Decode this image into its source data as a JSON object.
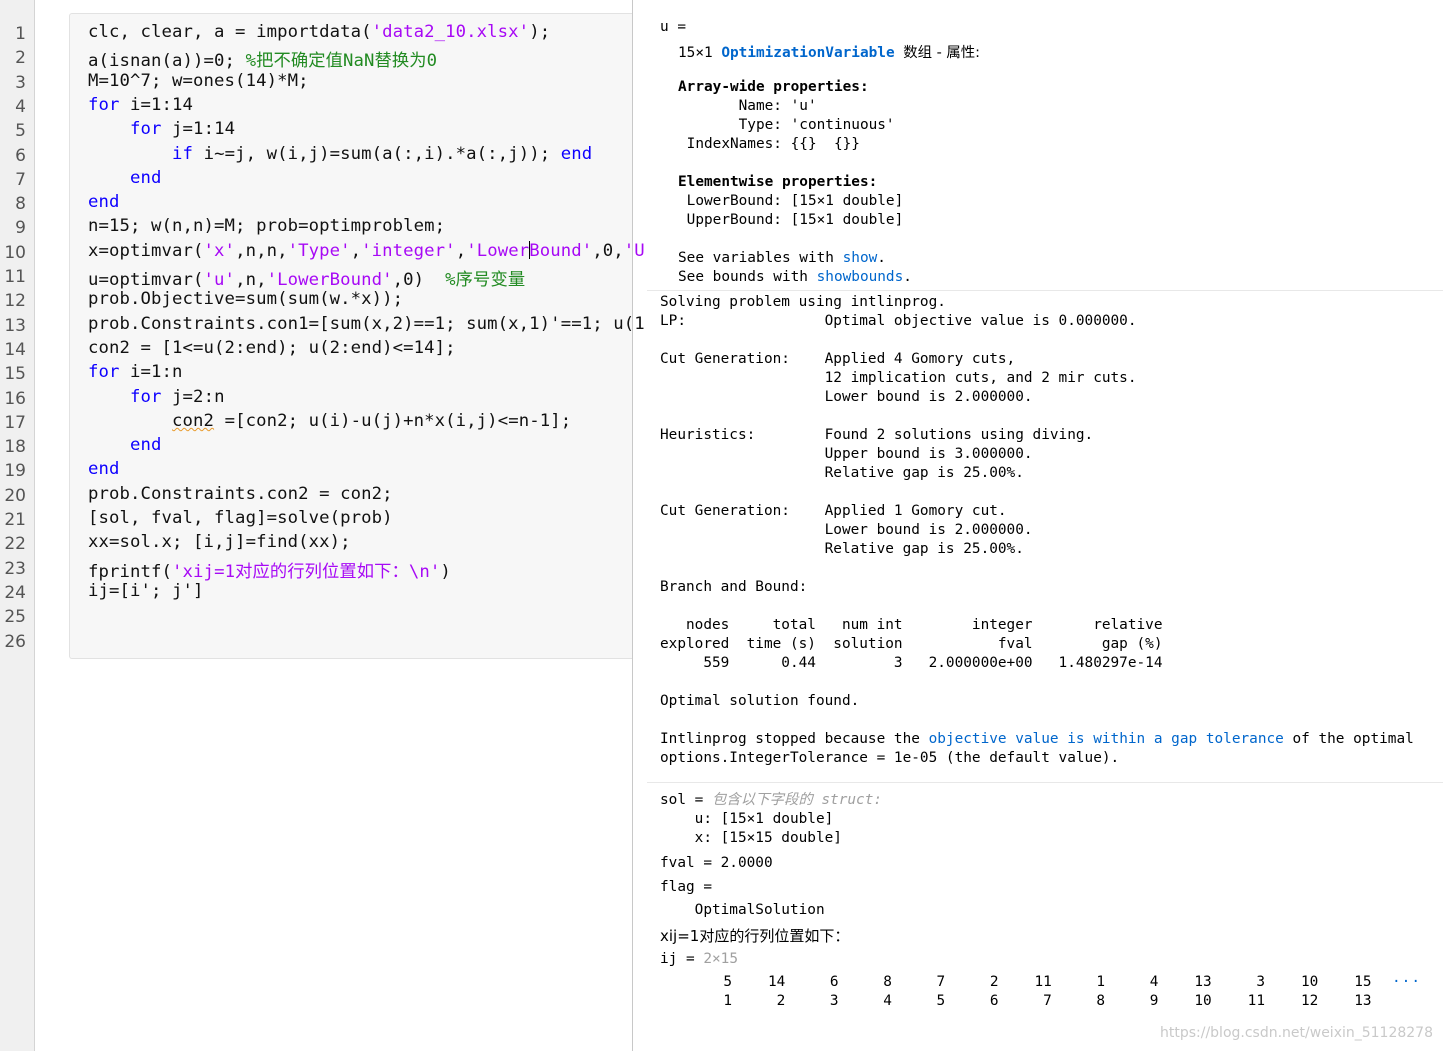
{
  "editor": {
    "line_numbers": [
      "1",
      "2",
      "3",
      "4",
      "5",
      "6",
      "7",
      "8",
      "9",
      "10",
      "11",
      "12",
      "13",
      "14",
      "15",
      "16",
      "17",
      "18",
      "19",
      "20",
      "21",
      "22",
      "23",
      "24",
      "25",
      "26"
    ],
    "lines": [
      [
        {
          "t": "clc, clear, a = importdata(",
          "c": "n"
        },
        {
          "t": "'data2_10.xlsx'",
          "c": "s"
        },
        {
          "t": ");",
          "c": "n"
        }
      ],
      [
        {
          "t": "a(isnan(a))=0; ",
          "c": "n"
        },
        {
          "t": "%把不确定值NaN替换为0",
          "c": "c"
        }
      ],
      [
        {
          "t": "M=10^7; w=ones(14)*M;",
          "c": "n"
        }
      ],
      [
        {
          "t": "for",
          "c": "k"
        },
        {
          "t": " i=1:14",
          "c": "n"
        }
      ],
      [
        {
          "t": "    ",
          "c": "n"
        },
        {
          "t": "for",
          "c": "k"
        },
        {
          "t": " j=1:14",
          "c": "n"
        }
      ],
      [
        {
          "t": "        ",
          "c": "n"
        },
        {
          "t": "if",
          "c": "k"
        },
        {
          "t": " i~=j, w(i,j)=sum(a(:,i).*a(:,j)); ",
          "c": "n"
        },
        {
          "t": "end",
          "c": "k"
        }
      ],
      [
        {
          "t": "    ",
          "c": "n"
        },
        {
          "t": "end",
          "c": "k"
        }
      ],
      [
        {
          "t": "end",
          "c": "k"
        }
      ],
      [
        {
          "t": "n=15; w(n,n)=M; prob=optimproblem;",
          "c": "n"
        }
      ],
      [
        {
          "t": "x=optimvar(",
          "c": "n"
        },
        {
          "t": "'x'",
          "c": "s"
        },
        {
          "t": ",n,n,",
          "c": "n"
        },
        {
          "t": "'Type'",
          "c": "s"
        },
        {
          "t": ",",
          "c": "n"
        },
        {
          "t": "'integer'",
          "c": "s"
        },
        {
          "t": ",",
          "c": "n"
        },
        {
          "t": "'Lower",
          "c": "s"
        },
        {
          "t": "",
          "c": "cursor"
        },
        {
          "t": "Bound'",
          "c": "s"
        },
        {
          "t": ",0,",
          "c": "n"
        },
        {
          "t": "'U",
          "c": "s"
        }
      ],
      [
        {
          "t": "u=optimvar(",
          "c": "n"
        },
        {
          "t": "'u'",
          "c": "s"
        },
        {
          "t": ",n,",
          "c": "n"
        },
        {
          "t": "'LowerBound'",
          "c": "s"
        },
        {
          "t": ",0)  ",
          "c": "n"
        },
        {
          "t": "%序号变量",
          "c": "c"
        }
      ],
      [
        {
          "t": "prob.Objective=sum(sum(w.*x));",
          "c": "n"
        }
      ],
      [
        {
          "t": "prob.Constraints.con1=[sum(x,2)==1; sum(x,1)'==1; u(1",
          "c": "n"
        }
      ],
      [
        {
          "t": "con2 = [1<=u(2:end); u(2:end)<=14];",
          "c": "n"
        }
      ],
      [
        {
          "t": "for",
          "c": "k"
        },
        {
          "t": " i=1:n",
          "c": "n"
        }
      ],
      [
        {
          "t": "    ",
          "c": "n"
        },
        {
          "t": "for",
          "c": "k"
        },
        {
          "t": " j=2:n",
          "c": "n"
        }
      ],
      [
        {
          "t": "        ",
          "c": "n"
        },
        {
          "t": "con2",
          "c": "w"
        },
        {
          "t": " =[con2; u(i)-u(j)+n*x(i,j)<=n-1];",
          "c": "n"
        }
      ],
      [
        {
          "t": "    ",
          "c": "n"
        },
        {
          "t": "end",
          "c": "k"
        }
      ],
      [
        {
          "t": "end",
          "c": "k"
        }
      ],
      [
        {
          "t": "prob.Constraints.con2 = con2;",
          "c": "n"
        }
      ],
      [
        {
          "t": "[sol, fval, flag]=solve(prob)",
          "c": "n"
        }
      ],
      [
        {
          "t": "xx=sol.x; [i,j]=find(xx);",
          "c": "n"
        }
      ],
      [
        {
          "t": "fprintf(",
          "c": "n"
        },
        {
          "t": "'xij=1对应的行列位置如下：\\n'",
          "c": "s"
        },
        {
          "t": ")",
          "c": "n"
        }
      ],
      [
        {
          "t": "ij=[i'; j']",
          "c": "n"
        }
      ],
      [],
      []
    ]
  },
  "output": {
    "var_block": {
      "u_eq": "u =",
      "size": "15×1",
      "class_link": "OptimizationVariable",
      "array_text": "数组 - 属性:",
      "arraywide_header": "Array-wide properties:",
      "name_line": "       Name: 'u'",
      "type_line": "       Type: 'continuous'",
      "index_line": " IndexNames: {{}  {}}",
      "elementwise_header": "Elementwise properties:",
      "lower_line": " LowerBound: [15×1 double]",
      "upper_line": " UpperBound: [15×1 double]",
      "see_vars_prefix": "See variables with ",
      "see_vars_link": "show",
      "see_bounds_prefix": "See bounds with ",
      "see_bounds_link": "showbounds",
      "period": "."
    },
    "solver_lines": [
      "Solving problem using intlinprog.",
      "LP:                Optimal objective value is 0.000000.",
      "",
      "Cut Generation:    Applied 4 Gomory cuts,",
      "                   12 implication cuts, and 2 mir cuts.",
      "                   Lower bound is 2.000000.",
      "",
      "Heuristics:        Found 2 solutions using diving.",
      "                   Upper bound is 3.000000.",
      "                   Relative gap is 25.00%.",
      "",
      "Cut Generation:    Applied 1 Gomory cut.",
      "                   Lower bound is 2.000000.",
      "                   Relative gap is 25.00%.",
      "",
      "Branch and Bound:",
      "",
      "   nodes     total   num int        integer       relative",
      "explored  time (s)  solution           fval        gap (%)",
      "     559      0.44         3   2.000000e+00   1.480297e-14",
      "",
      "Optimal solution found."
    ],
    "stopped_prefix": "Intlinprog stopped because the ",
    "stopped_link": "objective value is within a gap tolerance",
    "stopped_suffix": " of the optimal",
    "options_line": "options.IntegerTolerance = 1e-05 (the default value).",
    "sol_label": "sol = ",
    "sol_desc": "包含以下字段的 struct:",
    "sol_u": "    u: [15×1 double]",
    "sol_x": "    x: [15×15 double]",
    "fval_line": "fval = 2.0000",
    "flag_line": "flag =",
    "flag_value": "    OptimalSolution",
    "fprintf_out": "xij=1对应的行列位置如下：",
    "ij_label": "ij = ",
    "ij_size": "2×15",
    "ij_row1": [
      "5",
      "14",
      "6",
      "8",
      "7",
      "2",
      "11",
      "1",
      "4",
      "13",
      "3",
      "10",
      "15"
    ],
    "ij_row2": [
      "1",
      "2",
      "3",
      "4",
      "5",
      "6",
      "7",
      "8",
      "9",
      "10",
      "11",
      "12",
      "13"
    ],
    "ij_more": "···"
  },
  "watermark": "https://blog.csdn.net/weixin_51128278"
}
